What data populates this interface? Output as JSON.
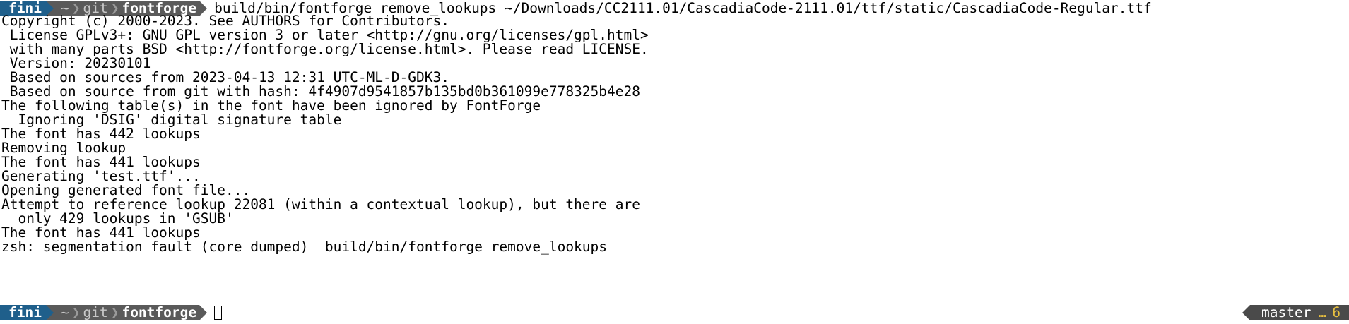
{
  "prompt": {
    "user": "fini",
    "home": "~",
    "dir1": "git",
    "dir2": "fontforge",
    "separator": "❯"
  },
  "command": "build/bin/fontforge remove_lookups ~/Downloads/CC2111.01/CascadiaCode-2111.01/ttf/static/CascadiaCode-Regular.ttf",
  "output": [
    "Copyright (c) 2000-2023. See AUTHORS for Contributors.",
    " License GPLv3+: GNU GPL version 3 or later <http://gnu.org/licenses/gpl.html>",
    " with many parts BSD <http://fontforge.org/license.html>. Please read LICENSE.",
    " Version: 20230101",
    " Based on sources from 2023-04-13 12:31 UTC-ML-D-GDK3.",
    " Based on source from git with hash: 4f4907d9541857b135bd0b361099e778325b4e28",
    "The following table(s) in the font have been ignored by FontForge",
    "  Ignoring 'DSIG' digital signature table",
    "The font has 442 lookups",
    "Removing lookup",
    "The font has 441 lookups",
    "Generating 'test.ttf'...",
    "Opening generated font file...",
    "Attempt to reference lookup 22081 (within a contextual lookup), but there are",
    "  only 429 lookups in 'GSUB'",
    "The font has 441 lookups",
    "zsh: segmentation fault (core dumped)  build/bin/fontforge remove_lookups"
  ],
  "right_prompt": {
    "branch_icon": "",
    "branch": "master",
    "ellipsis": "…",
    "count": "6"
  },
  "colors": {
    "user_bg": "#1f5f8b",
    "dir_bg": "#5a5a5a",
    "right_bg": "#4a4a4a",
    "count": "#e8c040"
  },
  "icons": {
    "branch": "git-branch-icon",
    "cursor": "terminal-cursor"
  }
}
